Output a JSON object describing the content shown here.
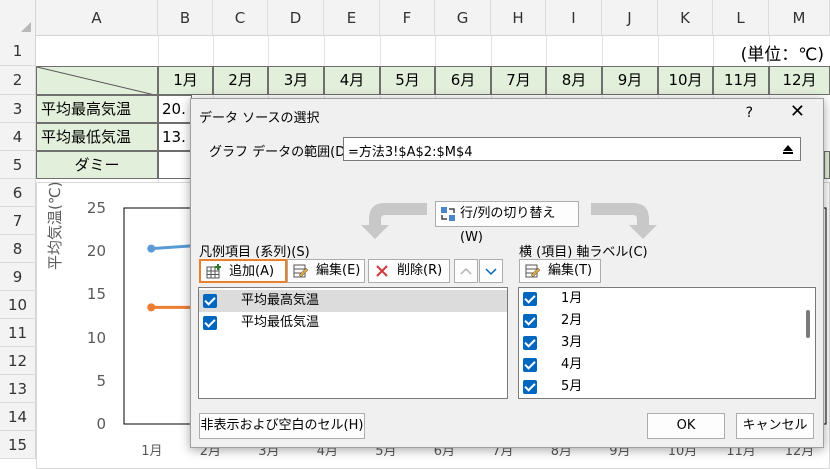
{
  "spreadsheet": {
    "columns": [
      "A",
      "B",
      "C",
      "D",
      "E",
      "F",
      "G",
      "H",
      "I",
      "J",
      "K",
      "L",
      "M"
    ],
    "rows": [
      "1",
      "2",
      "3",
      "4",
      "5",
      "6",
      "7",
      "8",
      "9",
      "10",
      "11",
      "12",
      "13",
      "14",
      "15"
    ],
    "unit_label": "(単位：℃)",
    "month_headers": [
      "1月",
      "2月",
      "3月",
      "4月",
      "5月",
      "6月",
      "7月",
      "8月",
      "9月",
      "10月",
      "11月",
      "12月"
    ],
    "row3_label": "平均最高気温",
    "row3_b": "20.",
    "row4_label": "平均最低気温",
    "row4_b": "13.",
    "row5_label": "ダミー"
  },
  "chart_data": {
    "type": "line",
    "ylabel": "平均気温(℃)",
    "ylim": [
      0,
      25
    ],
    "yticks": [
      "25",
      "20",
      "15",
      "10",
      "5",
      "0"
    ],
    "categories": [
      "1月",
      "2月",
      "3月",
      "4月",
      "5月",
      "6月",
      "7月",
      "8月",
      "9月",
      "10月",
      "11月",
      "12月"
    ],
    "series": [
      {
        "name": "平均最高気温",
        "color": "#5b9bd5",
        "values": [
          20.3
        ]
      },
      {
        "name": "平均最低気温",
        "color": "#ed7d31",
        "values": [
          13.5
        ]
      }
    ]
  },
  "dialog": {
    "title": "データ ソースの選択",
    "help": "?",
    "close": "✕",
    "range_label": "グラフ データの範囲(D):",
    "range_value": "=方法3!$A$2:$M$4",
    "switch_label": "行/列の切り替え(W)",
    "legend_section_label": "凡例項目 (系列)(S)",
    "axis_section_label": "横 (項目) 軸ラベル(C)",
    "add_label": "追加(A)",
    "edit_label": "編集(E)",
    "delete_label": "削除(R)",
    "axis_edit_label": "編集(T)",
    "series_items": [
      "平均最高気温",
      "平均最低気温"
    ],
    "axis_items": [
      "1月",
      "2月",
      "3月",
      "4月",
      "5月"
    ],
    "hidden_cells_label": "非表示および空白のセル(H)",
    "ok_label": "OK",
    "cancel_label": "キャンセル"
  }
}
